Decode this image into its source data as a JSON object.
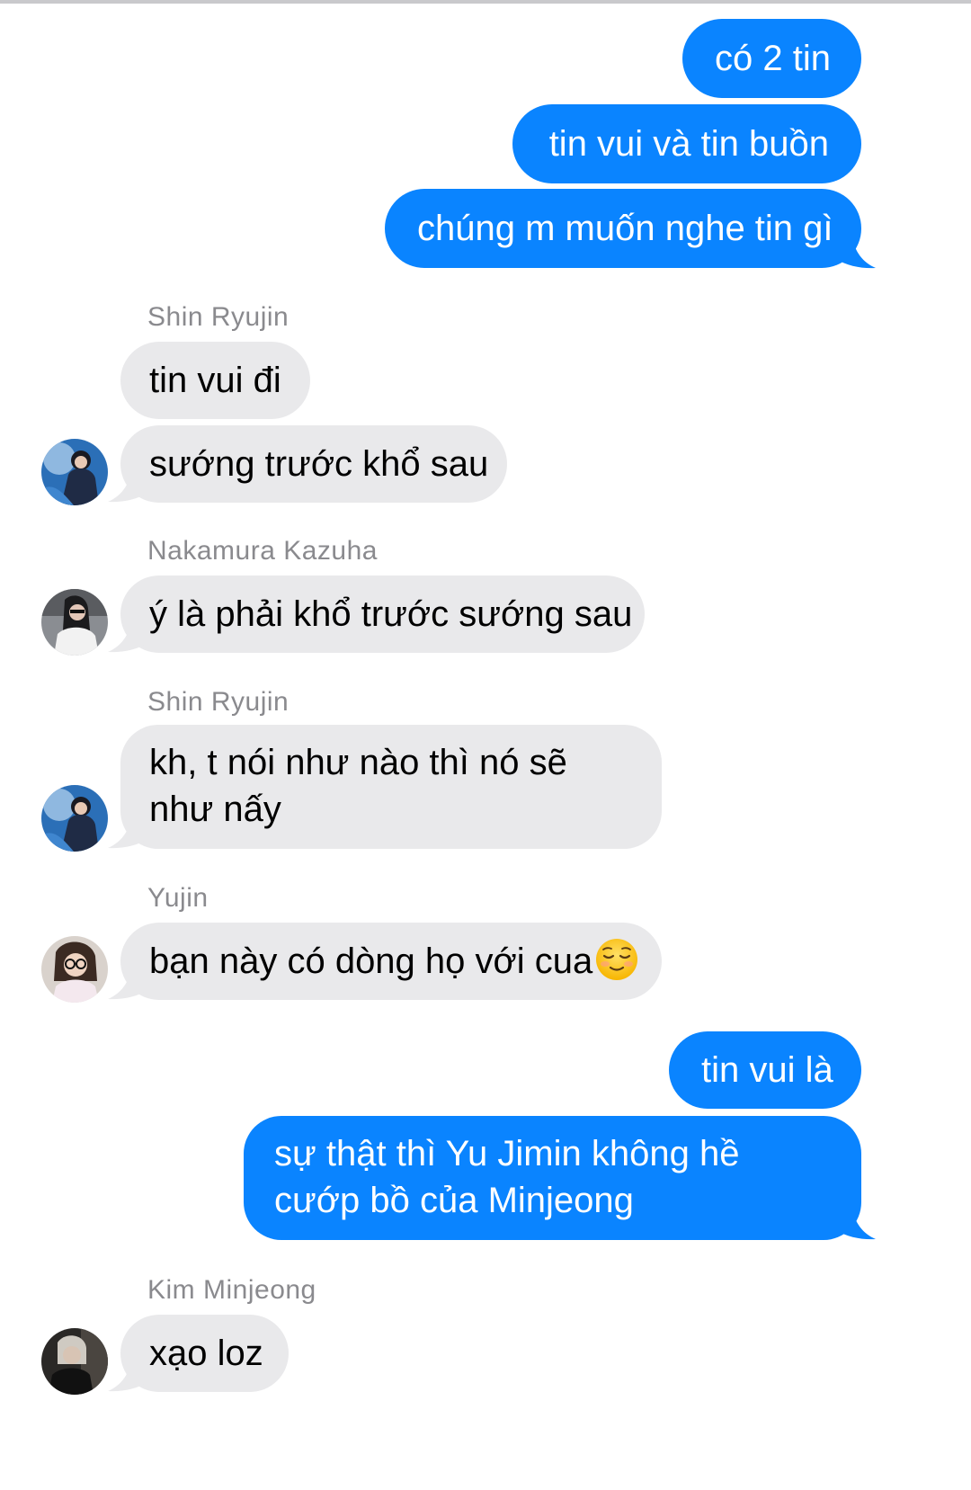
{
  "messages": [
    {
      "id": "m1",
      "side": "out",
      "text": "có 2 tin"
    },
    {
      "id": "m2",
      "side": "out",
      "text": "tin vui và tin buồn"
    },
    {
      "id": "m3",
      "side": "out",
      "text": "chúng m muốn nghe tin gì"
    },
    {
      "id": "m4",
      "side": "in",
      "sender": "Shin Ryujin",
      "text": "tin vui đi"
    },
    {
      "id": "m5",
      "side": "in",
      "text": "sướng trước khổ sau"
    },
    {
      "id": "m6",
      "side": "in",
      "sender": "Nakamura Kazuha",
      "text": "ý là phải khổ trước sướng sau"
    },
    {
      "id": "m7",
      "side": "in",
      "sender": "Shin Ryujin",
      "text": "kh, t nói như nào thì nó sẽ như nấy"
    },
    {
      "id": "m8",
      "side": "in",
      "sender": "Yujin",
      "text": "bạn này có dòng họ với cua",
      "emoji": "relieved-face-emoji"
    },
    {
      "id": "m9",
      "side": "out",
      "text": "tin vui là"
    },
    {
      "id": "m10",
      "side": "out",
      "text": "sự thật thì Yu Jimin không hề cướp bồ của Minjeong"
    },
    {
      "id": "m11",
      "side": "in",
      "sender": "Kim Minjeong",
      "text": "xạo loz"
    }
  ],
  "colors": {
    "outgoing_bubble": "#0a84ff",
    "incoming_bubble": "#e9e9eb",
    "sender_name": "#8a8a8e"
  },
  "icons": [
    "avatar-shin-ryujin",
    "avatar-nakamura-kazuha",
    "avatar-yujin",
    "avatar-kim-minjeong",
    "relieved-face-emoji"
  ]
}
